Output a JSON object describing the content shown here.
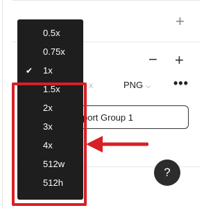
{
  "panel": {
    "plus_top": "+",
    "minus": "−",
    "plus_mid": "+",
    "scale_fragment": "x",
    "format": "PNG",
    "more": "•••",
    "export_button": "port Group 1",
    "help": "?"
  },
  "dropdown": {
    "selected": "1x",
    "items": [
      {
        "label": "0.5x",
        "checked": false
      },
      {
        "label": "0.75x",
        "checked": false
      },
      {
        "label": "1x",
        "checked": true
      },
      {
        "label": "1.5x",
        "checked": false
      },
      {
        "label": "2x",
        "checked": false
      },
      {
        "label": "3x",
        "checked": false
      },
      {
        "label": "4x",
        "checked": false
      },
      {
        "label": "512w",
        "checked": false
      },
      {
        "label": "512h",
        "checked": false
      }
    ]
  },
  "annotation": {
    "highlight_color": "#d71f26",
    "arrow_color": "#d71f26"
  }
}
